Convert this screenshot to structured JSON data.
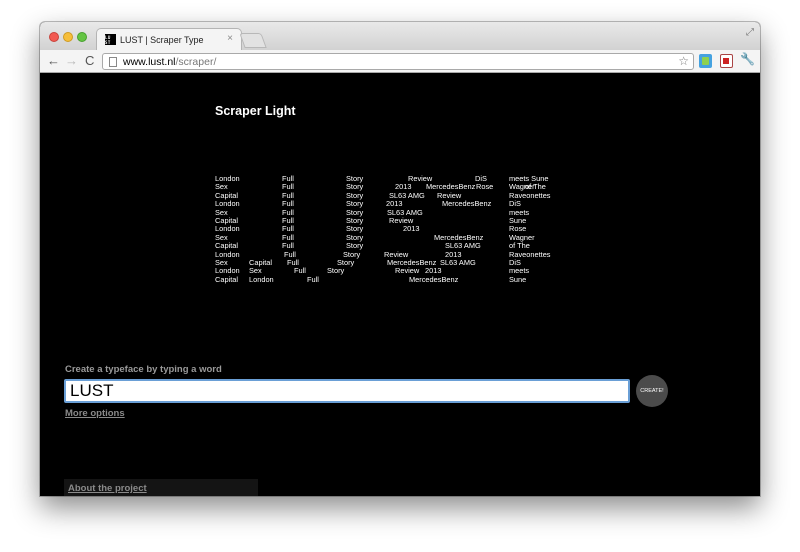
{
  "browser": {
    "tab_favicon": "LU ST",
    "tab_title": "LUST | Scraper Type",
    "tab_close": "×",
    "url_host": "www.lust.nl",
    "url_path": "/scraper/",
    "back": "←",
    "forward": "→",
    "reload": "C",
    "star": "☆",
    "wrench": "🔧",
    "resize": "⤢"
  },
  "page": {
    "font_name": "Scraper Light",
    "prompt": "Create a typeface by typing a word",
    "input_value": "LUST",
    "create_label": "CREATE!",
    "more_options": "More options",
    "about_link": "About the project"
  },
  "specimen": {
    "rows": [
      [
        "London",
        "Full",
        "Story",
        "Review",
        "DiS",
        "meets Sune"
      ],
      [
        "Sex",
        "Full",
        "Story",
        "2013",
        "MercedesBenz",
        "Rose",
        "Wagner",
        "of The"
      ],
      [
        "Capital",
        "Full",
        "Story",
        "SL63 AMG",
        "Review",
        "Raveonettes"
      ],
      [
        "London",
        "Full",
        "Story",
        "2013",
        "MercedesBenz",
        "DiS"
      ],
      [
        "Sex",
        "Full",
        "Story",
        "SL63 AMG",
        "meets"
      ],
      [
        "Capital",
        "Full",
        "Story",
        "Review",
        "Sune"
      ],
      [
        "London",
        "Full",
        "Story",
        "2013",
        "Rose"
      ],
      [
        "Sex",
        "Full",
        "Story",
        "MercedesBenz",
        "Wagner"
      ],
      [
        "Capital",
        "Full",
        "Story",
        "SL63 AMG",
        "of The"
      ],
      [
        "London",
        "Full",
        "Story",
        "Review",
        "2013",
        "Raveonettes"
      ],
      [
        "Sex",
        "Capital",
        "Full",
        "Story",
        "MercedesBenz",
        "SL63 AMG",
        "DiS"
      ],
      [
        "London",
        "Sex",
        "Full",
        "Story",
        "Review",
        "2013",
        "meets"
      ],
      [
        "Capital",
        "London",
        "Full",
        "MercedesBenz",
        "Sune"
      ]
    ]
  }
}
